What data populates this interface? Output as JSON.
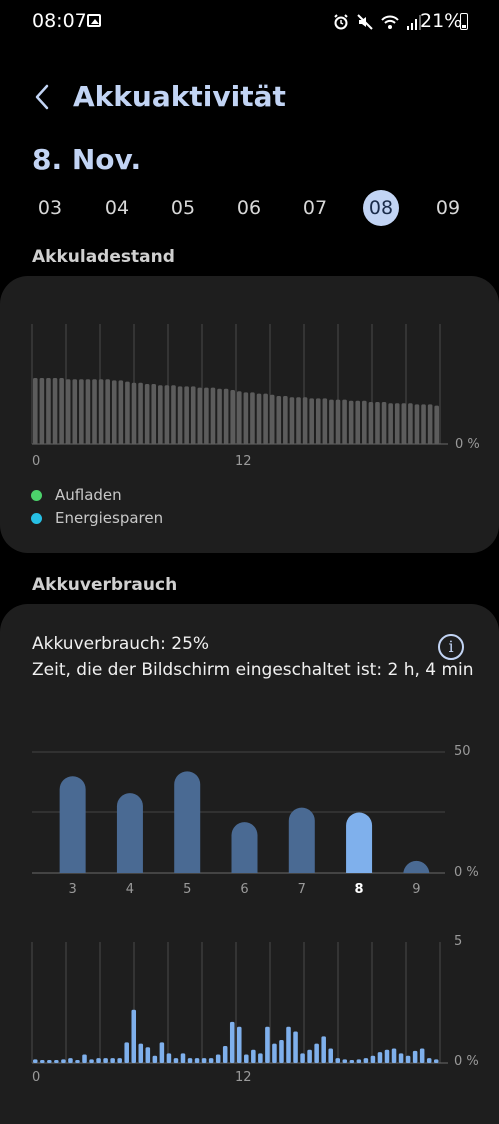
{
  "status_bar": {
    "time": "08:07",
    "battery_percent": "21%",
    "icons": [
      "image-icon",
      "alarm-icon",
      "mute-icon",
      "wifi-icon",
      "signal-icon",
      "battery-icon"
    ]
  },
  "header": {
    "title": "Akkuaktivität",
    "back_icon": "chevron-left-icon"
  },
  "date_label": "8. Nov.",
  "days": [
    {
      "label": "03",
      "selected": false
    },
    {
      "label": "04",
      "selected": false
    },
    {
      "label": "05",
      "selected": false
    },
    {
      "label": "06",
      "selected": false
    },
    {
      "label": "07",
      "selected": false
    },
    {
      "label": "08",
      "selected": true
    },
    {
      "label": "09",
      "selected": false
    }
  ],
  "charge_section": {
    "title": "Akkuladestand",
    "right_label": "0 %",
    "x_ticks": [
      "0",
      "12"
    ],
    "legend": [
      {
        "label": "Aufladen",
        "color": "#4cd26b"
      },
      {
        "label": "Energiesparen",
        "color": "#27c0e4"
      }
    ]
  },
  "usage_section": {
    "title": "Akkuverbrauch",
    "usage_text": "Akkuverbrauch: 25%",
    "screen_time_text": "Zeit, die der Bildschirm eingeschaltet ist: 2 h, 4 min",
    "info_icon": "info-icon"
  },
  "colors": {
    "accent": "#c2d4f4",
    "bar_level": "#5c5c5c",
    "bar_past": "#4a6a93",
    "bar_selected": "#7fb0ec",
    "card": "#1e1e1e"
  },
  "chart_data": [
    {
      "type": "bar",
      "title": "Akkuladestand",
      "y_max_label": "",
      "y_min_label": "0 %",
      "x_ticks": [
        "0",
        "12"
      ],
      "values": [
        55,
        55,
        55,
        55,
        55,
        54,
        54,
        54,
        54,
        54,
        54,
        54,
        53,
        53,
        52,
        51,
        51,
        50,
        50,
        49,
        49,
        49,
        48,
        48,
        48,
        47,
        47,
        47,
        46,
        46,
        45,
        44,
        43,
        43,
        42,
        42,
        41,
        40,
        40,
        39,
        39,
        39,
        38,
        38,
        38,
        37,
        37,
        37,
        36,
        36,
        36,
        35,
        35,
        35,
        34,
        34,
        34,
        34,
        33,
        33,
        33,
        32
      ],
      "ylim": [
        0,
        100
      ]
    },
    {
      "type": "bar",
      "title": "Akkuverbrauch",
      "categories": [
        "3",
        "4",
        "5",
        "6",
        "7",
        "8",
        "9"
      ],
      "values": [
        40,
        33,
        42,
        21,
        27,
        25,
        5
      ],
      "selected_index": 5,
      "y_ticks": [
        "50",
        "0 %"
      ],
      "ylim": [
        0,
        50
      ]
    },
    {
      "type": "bar",
      "title": "",
      "x_ticks": [
        "0",
        "12"
      ],
      "y_ticks": [
        "5",
        "0 %"
      ],
      "values": [
        0.15,
        0.12,
        0.12,
        0.12,
        0.15,
        0.2,
        0.12,
        0.35,
        0.15,
        0.2,
        0.2,
        0.2,
        0.2,
        0.85,
        2.2,
        0.8,
        0.65,
        0.3,
        0.85,
        0.4,
        0.2,
        0.4,
        0.2,
        0.2,
        0.2,
        0.2,
        0.35,
        0.7,
        1.7,
        1.5,
        0.35,
        0.55,
        0.4,
        1.5,
        0.8,
        0.95,
        1.5,
        1.3,
        0.4,
        0.55,
        0.8,
        1.1,
        0.6,
        0.2,
        0.15,
        0.1,
        0.15,
        0.2,
        0.3,
        0.45,
        0.55,
        0.6,
        0.4,
        0.3,
        0.5,
        0.6,
        0.2,
        0.15
      ],
      "ylim": [
        0,
        5
      ]
    }
  ]
}
